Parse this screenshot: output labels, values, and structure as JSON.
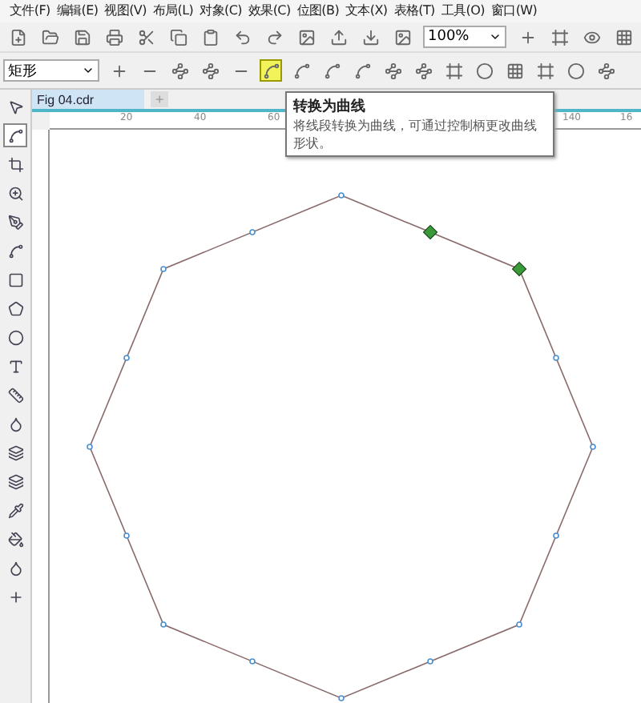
{
  "menu": [
    "文件(F)",
    "编辑(E)",
    "视图(V)",
    "布局(L)",
    "对象(C)",
    "效果(C)",
    "位图(B)",
    "文本(X)",
    "表格(T)",
    "工具(O)",
    "窗口(W)"
  ],
  "zoom": {
    "value": "100%"
  },
  "property_bar": {
    "shape_type": "矩形",
    "tools": [
      {
        "selected": false
      },
      {
        "selected": false
      },
      {
        "selected": false
      },
      {
        "selected": false
      },
      {
        "selected": false
      },
      {
        "selected": true
      },
      {
        "selected": false
      },
      {
        "selected": false
      },
      {
        "selected": false
      },
      {
        "selected": false
      },
      {
        "selected": false
      },
      {
        "selected": false
      },
      {
        "selected": false
      },
      {
        "selected": false
      },
      {
        "selected": false
      },
      {
        "selected": false
      },
      {
        "selected": false
      }
    ]
  },
  "document_tab": {
    "title": "Fig 04.cdr",
    "add_tab": "+"
  },
  "ruler": {
    "labels": [
      "20",
      "40",
      "60",
      "140",
      "16"
    ]
  },
  "toolbox": [
    {
      "selected": false
    },
    {
      "selected": true
    },
    {
      "selected": false
    },
    {
      "selected": false
    },
    {
      "selected": false
    },
    {
      "selected": false
    },
    {
      "selected": false
    },
    {
      "selected": false
    },
    {
      "selected": false
    },
    {
      "selected": false
    },
    {
      "selected": false
    },
    {
      "selected": false
    },
    {
      "selected": false
    },
    {
      "selected": false
    },
    {
      "selected": false
    },
    {
      "selected": false
    },
    {
      "selected": false
    },
    {
      "selected": false
    }
  ],
  "tooltip": {
    "title": "转换为曲线",
    "text": "将线段转换为曲线，可通过控制柄更改曲线形状。"
  },
  "nodes": [
    {
      "selected": false
    },
    {
      "selected": true
    },
    {
      "selected": true
    },
    {
      "selected": false
    },
    {
      "selected": false
    },
    {
      "selected": false
    },
    {
      "selected": false
    },
    {
      "selected": false
    },
    {
      "selected": false
    },
    {
      "selected": false
    },
    {
      "selected": false
    },
    {
      "selected": false
    },
    {
      "selected": false
    },
    {
      "selected": false
    },
    {
      "selected": false
    },
    {
      "selected": false
    }
  ]
}
